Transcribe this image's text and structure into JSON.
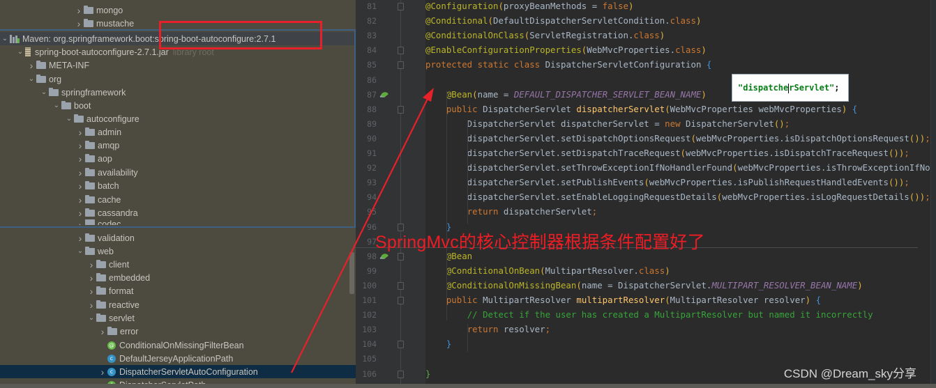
{
  "tree": {
    "rows": [
      {
        "label": "mongo",
        "type": "folder",
        "chevron": ">"
      },
      {
        "label": "mustache",
        "type": "folder",
        "chevron": ">"
      },
      {
        "label": "Maven: org.springframework.boot:spring-boot-autoconfigure:2.7.1",
        "type": "maven",
        "chevron": "v"
      },
      {
        "label": "spring-boot-autoconfigure-2.7.1.jar",
        "hint": "library root",
        "type": "jar",
        "chevron": "v"
      },
      {
        "label": "META-INF",
        "type": "folder",
        "chevron": ">"
      },
      {
        "label": "org",
        "type": "folder",
        "chevron": "v"
      },
      {
        "label": "springframework",
        "type": "folder",
        "chevron": "v"
      },
      {
        "label": "boot",
        "type": "folder",
        "chevron": "v"
      },
      {
        "label": "autoconfigure",
        "type": "folder",
        "chevron": "v"
      },
      {
        "label": "admin",
        "type": "folder",
        "chevron": ">"
      },
      {
        "label": "amqp",
        "type": "folder",
        "chevron": ">"
      },
      {
        "label": "aop",
        "type": "folder",
        "chevron": ">"
      },
      {
        "label": "availability",
        "type": "folder",
        "chevron": ">"
      },
      {
        "label": "batch",
        "type": "folder",
        "chevron": ">"
      },
      {
        "label": "cache",
        "type": "folder",
        "chevron": ">"
      },
      {
        "label": "cassandra",
        "type": "folder",
        "chevron": ">"
      },
      {
        "label": "codec",
        "type": "folder",
        "chevron": ">"
      },
      {
        "label": "validation",
        "type": "folder",
        "chevron": ">"
      },
      {
        "label": "web",
        "type": "folder",
        "chevron": "v"
      },
      {
        "label": "client",
        "type": "folder",
        "chevron": ">"
      },
      {
        "label": "embedded",
        "type": "folder",
        "chevron": ">"
      },
      {
        "label": "format",
        "type": "folder",
        "chevron": ">"
      },
      {
        "label": "reactive",
        "type": "folder",
        "chevron": ">"
      },
      {
        "label": "servlet",
        "type": "folder",
        "chevron": "v"
      },
      {
        "label": "error",
        "type": "folder",
        "chevron": ">"
      },
      {
        "label": "ConditionalOnMissingFilterBean",
        "type": "annotation",
        "chevron": ""
      },
      {
        "label": "DefaultJerseyApplicationPath",
        "type": "class",
        "chevron": ""
      },
      {
        "label": "DispatcherServletAutoConfiguration",
        "type": "class",
        "chevron": ">"
      },
      {
        "label": "DispatcherServletPath",
        "type": "interface",
        "chevron": ""
      }
    ]
  },
  "editor": {
    "line_numbers": [
      "81",
      "82",
      "83",
      "84",
      "85",
      "86",
      "87",
      "88",
      "89",
      "90",
      "91",
      "92",
      "93",
      "94",
      "95",
      "96",
      "97",
      "98",
      "99",
      "100",
      "101",
      "102",
      "103",
      "104",
      "105",
      "106"
    ],
    "lines": [
      "@Configuration(proxyBeanMethods = false)",
      "@Conditional(DefaultDispatcherServletCondition.class)",
      "@ConditionalOnClass(ServletRegistration.class)",
      "@EnableConfigurationProperties(WebMvcProperties.class)",
      "protected static class DispatcherServletConfiguration {",
      "",
      "    @Bean(name = DEFAULT_DISPATCHER_SERVLET_BEAN_NAME)",
      "    public DispatcherServlet dispatcherServlet(WebMvcProperties webMvcProperties) {",
      "        DispatcherServlet dispatcherServlet = new DispatcherServlet();",
      "        dispatcherServlet.setDispatchOptionsRequest(webMvcProperties.isDispatchOptionsRequest());",
      "        dispatcherServlet.setDispatchTraceRequest(webMvcProperties.isDispatchTraceRequest());",
      "        dispatcherServlet.setThrowExceptionIfNoHandlerFound(webMvcProperties.isThrowExceptionIfNoHandlerFound());",
      "        dispatcherServlet.setPublishEvents(webMvcProperties.isPublishRequestHandledEvents());",
      "        dispatcherServlet.setEnableLoggingRequestDetails(webMvcProperties.isLogRequestDetails());",
      "        return dispatcherServlet;",
      "    }",
      "",
      "    @Bean",
      "    @ConditionalOnBean(MultipartResolver.class)",
      "    @ConditionalOnMissingBean(name = DispatcherServlet.MULTIPART_RESOLVER_BEAN_NAME)",
      "    public MultipartResolver multipartResolver(MultipartResolver resolver) {",
      "        // Detect if the user has created a MultipartResolver but named it incorrectly",
      "        return resolver;",
      "    }",
      "",
      "}"
    ],
    "popup": {
      "value": "\"dispatcherServlet\"",
      "suffix": ";"
    }
  },
  "annotation": {
    "text": "SpringMvc的核心控制器根据条件配置好了",
    "color": "#ee1c24"
  },
  "watermark": {
    "text": "CSDN @Dream_sky分享"
  },
  "colors": {
    "highlight_box": "#e8202a",
    "selection": "#0e2c44"
  }
}
